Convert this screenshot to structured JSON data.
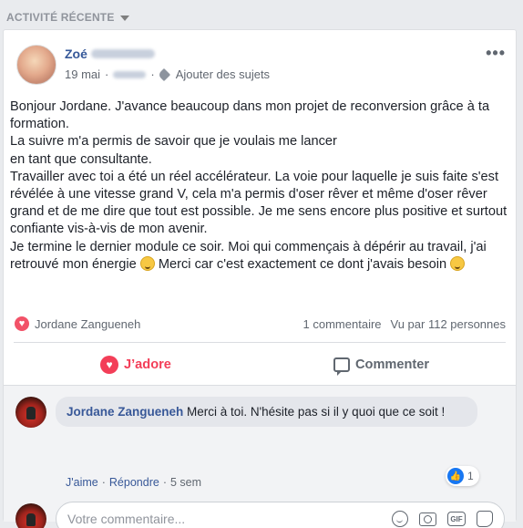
{
  "section": {
    "title": "ACTIVITÉ RÉCENTE"
  },
  "post": {
    "author_first": "Zoé",
    "date": "19 mai",
    "meta_sep": "·",
    "add_topics": "Ajouter des sujets",
    "more": "•••",
    "body": [
      "Bonjour Jordane. J'avance beaucoup dans mon projet de reconversion grâce à ta formation.",
      "La suivre m'a permis de savoir que je voulais me lancer",
      "en tant que consultante.",
      "Travailler avec toi a été un réel accélérateur. La voie pour laquelle je suis faite s'est révélée à une vitesse grand V, cela m'a permis d'oser rêver et même d'oser rêver grand et de me dire que tout est possible. Je me sens encore plus positive et surtout confiante vis-à-vis de mon avenir.",
      "Je termine le dernier module ce soir. Moi qui commençais à dépérir au travail, j'ai retrouvé mon énergie",
      "Merci car c'est exactement ce dont j'avais besoin"
    ],
    "reaction_name": "Jordane Zangueneh",
    "comments_count": "1 commentaire",
    "views": "Vu par 112 personnes"
  },
  "actions": {
    "adore": "J’adore",
    "comment": "Commenter"
  },
  "comment": {
    "author": "Jordane Zangueneh",
    "text": "Merci à toi. N'hésite pas si il y quoi que ce soit !",
    "like": "J'aime",
    "reply": "Répondre",
    "time": "5 sem",
    "sep": "·",
    "like_count": "1"
  },
  "compose": {
    "placeholder": "Votre commentaire..."
  },
  "icons": {
    "caret": "chevron-down-icon",
    "tag": "tag-icon",
    "heart": "heart-icon",
    "comment": "comment-bubble-icon",
    "emoji": "emoji-icon",
    "camera": "camera-icon",
    "gif": "gif-icon",
    "sticker": "sticker-icon",
    "like": "thumbs-up-icon"
  },
  "colors": {
    "link": "#365899",
    "love": "#f33e58",
    "like": "#1877f2"
  }
}
